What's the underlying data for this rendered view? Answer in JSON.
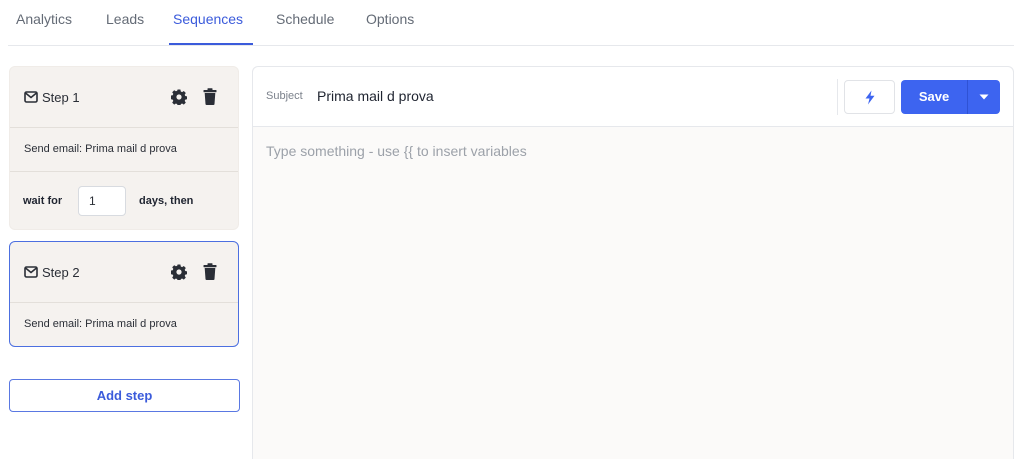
{
  "tabs": [
    {
      "label": "Analytics"
    },
    {
      "label": "Leads"
    },
    {
      "label": "Sequences"
    },
    {
      "label": "Schedule"
    },
    {
      "label": "Options"
    }
  ],
  "active_tab": "Sequences",
  "steps": [
    {
      "title": "Step 1",
      "body": "Send email: Prima mail d prova",
      "wait_label": "wait for",
      "wait_value": "1",
      "wait_suffix": "days, then"
    },
    {
      "title": "Step 2",
      "body": "Send email: Prima mail d prova"
    }
  ],
  "add_step_label": "Add step",
  "editor": {
    "subject_label": "Subject",
    "subject_value": "Prima mail d prova",
    "save_label": "Save",
    "body_placeholder": "Type something - use {{ to insert variables"
  },
  "icons": {
    "step": "mail-icon",
    "settings": "gear-icon",
    "delete": "trash-icon",
    "variables": "lightning-bolt-icon",
    "save_menu": "caret-down-icon"
  },
  "colors": {
    "accent": "#3b5bdb",
    "save_button": "#3d64f0",
    "card_background": "#f5f2ef"
  }
}
